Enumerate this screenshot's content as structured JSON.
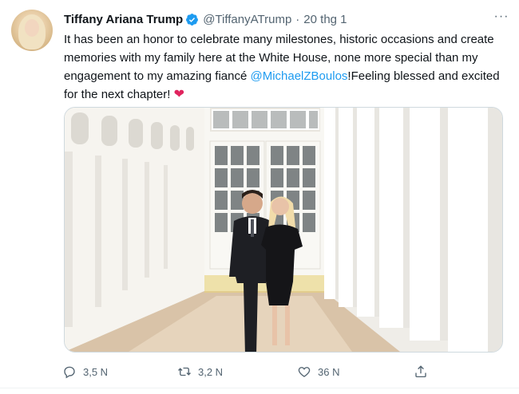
{
  "tweet": {
    "author_name": "Tiffany Ariana Trump",
    "author_handle": "@TiffanyATrump",
    "separator": "·",
    "date": "20 thg 1",
    "more_label": "···",
    "text_part1": "It has been an honor to celebrate many milestones, historic occasions and create memories with my family here at the White House, none more special than my engagement to my amazing fiancé ",
    "mention": "@MichaelZBoulos",
    "text_part2": "!Feeling blessed and excited for the next chapter! ",
    "heart": "❤"
  },
  "actions": {
    "reply_count": "3,5 N",
    "retweet_count": "3,2 N",
    "like_count": "36 N"
  },
  "icons": {
    "verified": "verified-badge-icon",
    "reply": "reply-icon",
    "retweet": "retweet-icon",
    "like": "heart-icon",
    "share": "share-icon"
  },
  "colors": {
    "link": "#1d9bf0",
    "verified": "#1d9bf0",
    "secondary_text": "#536471",
    "heart": "#e0245e"
  }
}
